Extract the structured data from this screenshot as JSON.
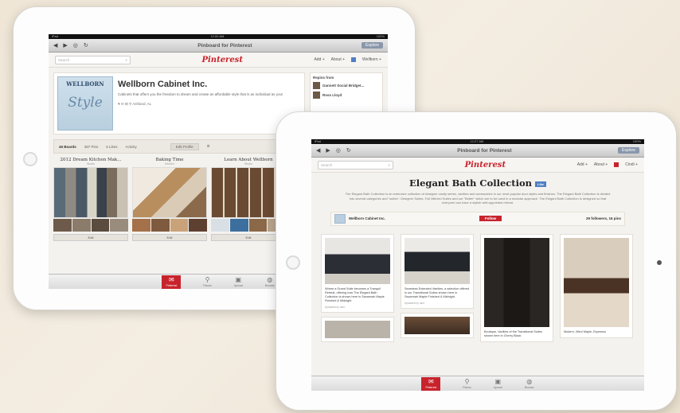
{
  "ipad_back": {
    "status": {
      "left": "iPad",
      "time": "12:00 AM",
      "right": "100%"
    },
    "safari": {
      "title": "Pinboard for Pinterest",
      "button": "Explore"
    },
    "pinterest": {
      "search_placeholder": "Search",
      "logo": "Pinterest",
      "add": "Add +",
      "about": "About +",
      "user": "Wellborn +"
    },
    "profile": {
      "logo_top": "WELLBORN",
      "logo_script": "Style",
      "name": "Wellborn Cabinet Inc.",
      "description": "Cabinets that offers you the freedom to dream and create an affordable style that is as individual as you!",
      "location": "Ashland, AL"
    },
    "repins": {
      "header": "Repins from",
      "items": [
        "Gannett Social Bridget...",
        "Ross Lloyd"
      ]
    },
    "tabs": [
      "46 Boards",
      "387 Pins",
      "6 Likes",
      "Activity"
    ],
    "edit_profile": "Edit Profile",
    "boards": [
      {
        "title": "2012 Dream Kitchen Mak...",
        "sub": "Studio",
        "edit": "Edit"
      },
      {
        "title": "Baking Time",
        "sub": "Kitchen",
        "edit": "Edit"
      },
      {
        "title": "Learn About Wellborn",
        "sub": "Studio",
        "edit": "Edit"
      }
    ],
    "tabbar": [
      "Pinterest",
      "Places",
      "Upload",
      "Browse"
    ]
  },
  "ipad_front": {
    "status": {
      "left": "iPad",
      "time": "12:27 AM",
      "right": "100%"
    },
    "safari": {
      "title": "Pinboard for Pinterest",
      "button": "Explore"
    },
    "pinterest": {
      "search_placeholder": "Search",
      "logo": "Pinterest",
      "add": "Add +",
      "about": "About +",
      "user": "Cindi +"
    },
    "board_title": "Elegant Bath Collection",
    "like": "Like",
    "board_description": "The Elegant Bath Collection is an extensive collection of designer vanity series, vanities and accessories in our most popular door styles and finishes. The Elegant Bath Collection is divided into several categories and \"suites\": Designer Suites, Full Mitered Suites and our \"Better\" which are to be used in a modular approach. The Elegant Bath Collection is designed so that everyone can have a stylish well-appointed retreat.",
    "owner": "Wellborn Cabinet Inc.",
    "follow": "Follow",
    "stats": "29 followers, 16 pins",
    "pins": [
      {
        "caption": "Where a Grand Suite becomes a Tranquil Retreat, offering how The Elegant Bath Collection is shown here in Savannah Maple Finished & Midnight.",
        "source": "Uploaded by user"
      },
      {
        "caption": "Seamless Extended Vanities, a selection offered in our Transitional Suites shown here in Savannah Maple Finished & Midnight.",
        "source": "Uploaded by user"
      },
      {
        "caption": "Boutique, Vanities of the Transitional Suites shown here in Cherry Black",
        "source": ""
      },
      {
        "caption": "Modern, Wind Maple, Espresso",
        "source": ""
      }
    ],
    "tabbar": [
      "Pinterest",
      "Places",
      "Upload",
      "Browse"
    ]
  }
}
